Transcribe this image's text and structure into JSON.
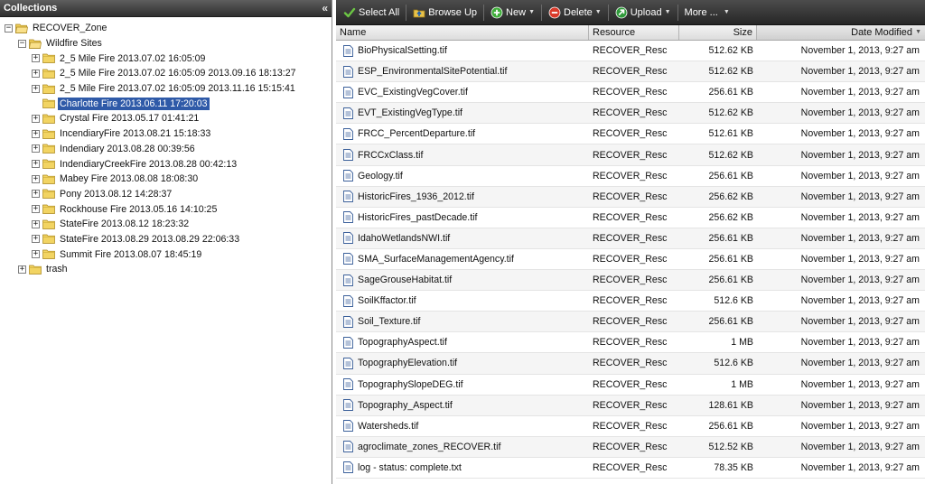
{
  "left_panel": {
    "title": "Collections",
    "collapse_glyph": "«",
    "tree": [
      {
        "label": "RECOVER_Zone",
        "level": 0,
        "expanded": true
      },
      {
        "label": "Wildfire Sites",
        "level": 1,
        "expanded": true
      },
      {
        "label": "2_5 Mile Fire 2013.07.02 16:05:09",
        "level": 2,
        "expanded": false
      },
      {
        "label": "2_5 Mile Fire 2013.07.02 16:05:09 2013.09.16 18:13:27",
        "level": 2,
        "expanded": false
      },
      {
        "label": "2_5 Mile Fire 2013.07.02 16:05:09 2013.11.16 15:15:41",
        "level": 2,
        "expanded": false
      },
      {
        "label": "Charlotte Fire 2013.06.11 17:20:03",
        "level": 2,
        "expanded": null,
        "selected": true
      },
      {
        "label": "Crystal Fire 2013.05.17 01:41:21",
        "level": 2,
        "expanded": false
      },
      {
        "label": "IncendiaryFire 2013.08.21 15:18:33",
        "level": 2,
        "expanded": false
      },
      {
        "label": "Indendiary 2013.08.28 00:39:56",
        "level": 2,
        "expanded": false
      },
      {
        "label": "IndendiaryCreekFire 2013.08.28 00:42:13",
        "level": 2,
        "expanded": false
      },
      {
        "label": "Mabey Fire 2013.08.08 18:08:30",
        "level": 2,
        "expanded": false
      },
      {
        "label": "Pony 2013.08.12 14:28:37",
        "level": 2,
        "expanded": false
      },
      {
        "label": "Rockhouse Fire 2013.05.16 14:10:25",
        "level": 2,
        "expanded": false
      },
      {
        "label": "StateFire 2013.08.12 18:23:32",
        "level": 2,
        "expanded": false
      },
      {
        "label": "StateFire 2013.08.29 2013.08.29 22:06:33",
        "level": 2,
        "expanded": false
      },
      {
        "label": "Summit Fire 2013.08.07 18:45:19",
        "level": 2,
        "expanded": false
      },
      {
        "label": "trash",
        "level": 1,
        "expanded": false
      }
    ]
  },
  "toolbar": {
    "select_all": "Select All",
    "browse_up": "Browse Up",
    "new": "New",
    "delete": "Delete",
    "upload": "Upload",
    "more": "More ...",
    "colors": {
      "check": "#6cc644",
      "new": "#3fae3a",
      "delete": "#d93a2a",
      "upload": "#2f9a3a"
    }
  },
  "grid": {
    "headers": {
      "name": "Name",
      "resource": "Resource",
      "size": "Size",
      "date": "Date Modified"
    },
    "rows": [
      {
        "name": "BioPhysicalSetting.tif",
        "resource": "RECOVER_Resc",
        "size": "512.62 KB",
        "date": "November 1, 2013, 9:27 am"
      },
      {
        "name": "ESP_EnvironmentalSitePotential.tif",
        "resource": "RECOVER_Resc",
        "size": "512.62 KB",
        "date": "November 1, 2013, 9:27 am"
      },
      {
        "name": "EVC_ExistingVegCover.tif",
        "resource": "RECOVER_Resc",
        "size": "256.61 KB",
        "date": "November 1, 2013, 9:27 am"
      },
      {
        "name": "EVT_ExistingVegType.tif",
        "resource": "RECOVER_Resc",
        "size": "512.62 KB",
        "date": "November 1, 2013, 9:27 am"
      },
      {
        "name": "FRCC_PercentDeparture.tif",
        "resource": "RECOVER_Resc",
        "size": "512.61 KB",
        "date": "November 1, 2013, 9:27 am"
      },
      {
        "name": "FRCCxClass.tif",
        "resource": "RECOVER_Resc",
        "size": "512.62 KB",
        "date": "November 1, 2013, 9:27 am"
      },
      {
        "name": "Geology.tif",
        "resource": "RECOVER_Resc",
        "size": "256.61 KB",
        "date": "November 1, 2013, 9:27 am"
      },
      {
        "name": "HistoricFires_1936_2012.tif",
        "resource": "RECOVER_Resc",
        "size": "256.62 KB",
        "date": "November 1, 2013, 9:27 am"
      },
      {
        "name": "HistoricFires_pastDecade.tif",
        "resource": "RECOVER_Resc",
        "size": "256.62 KB",
        "date": "November 1, 2013, 9:27 am"
      },
      {
        "name": "IdahoWetlandsNWI.tif",
        "resource": "RECOVER_Resc",
        "size": "256.61 KB",
        "date": "November 1, 2013, 9:27 am"
      },
      {
        "name": "SMA_SurfaceManagementAgency.tif",
        "resource": "RECOVER_Resc",
        "size": "256.61 KB",
        "date": "November 1, 2013, 9:27 am"
      },
      {
        "name": "SageGrouseHabitat.tif",
        "resource": "RECOVER_Resc",
        "size": "256.61 KB",
        "date": "November 1, 2013, 9:27 am"
      },
      {
        "name": "SoilKffactor.tif",
        "resource": "RECOVER_Resc",
        "size": "512.6 KB",
        "date": "November 1, 2013, 9:27 am"
      },
      {
        "name": "Soil_Texture.tif",
        "resource": "RECOVER_Resc",
        "size": "256.61 KB",
        "date": "November 1, 2013, 9:27 am"
      },
      {
        "name": "TopographyAspect.tif",
        "resource": "RECOVER_Resc",
        "size": "1 MB",
        "date": "November 1, 2013, 9:27 am"
      },
      {
        "name": "TopographyElevation.tif",
        "resource": "RECOVER_Resc",
        "size": "512.6 KB",
        "date": "November 1, 2013, 9:27 am"
      },
      {
        "name": "TopographySlopeDEG.tif",
        "resource": "RECOVER_Resc",
        "size": "1 MB",
        "date": "November 1, 2013, 9:27 am"
      },
      {
        "name": "Topography_Aspect.tif",
        "resource": "RECOVER_Resc",
        "size": "128.61 KB",
        "date": "November 1, 2013, 9:27 am"
      },
      {
        "name": "Watersheds.tif",
        "resource": "RECOVER_Resc",
        "size": "256.61 KB",
        "date": "November 1, 2013, 9:27 am"
      },
      {
        "name": "agroclimate_zones_RECOVER.tif",
        "resource": "RECOVER_Resc",
        "size": "512.52 KB",
        "date": "November 1, 2013, 9:27 am"
      },
      {
        "name": "log - status: complete.txt",
        "resource": "RECOVER_Resc",
        "size": "78.35 KB",
        "date": "November 1, 2013, 9:27 am"
      }
    ]
  }
}
